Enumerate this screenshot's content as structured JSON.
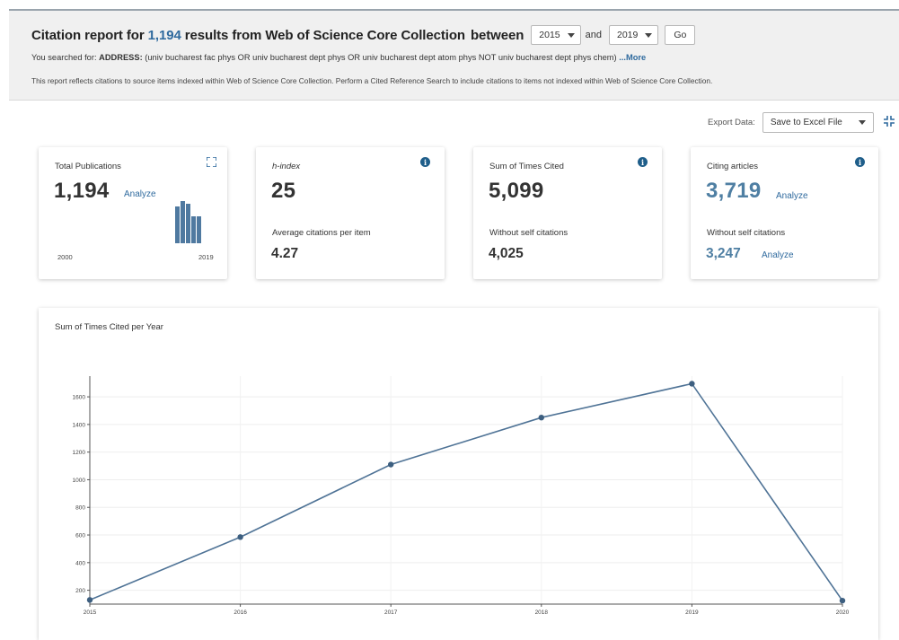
{
  "header": {
    "title_prefix": "Citation report for ",
    "title_count": "1,194",
    "title_suffix": " results from Web of Science Core Collection",
    "title_between": "between",
    "year_from": "2015",
    "and_label": "and",
    "year_to": "2019",
    "go_label": "Go",
    "searched_prefix": "You searched for: ",
    "searched_field": "ADDRESS:",
    "searched_query": " (univ bucharest fac phys OR univ bucharest dept phys OR univ bucharest dept atom phys NOT univ bucharest dept phys chem) ",
    "more_label": "...More",
    "note": "This report reflects citations to source items indexed within Web of Science Core Collection. Perform a Cited Reference Search to include citations to items not indexed within Web of Science Core Collection."
  },
  "export": {
    "label": "Export Data:",
    "selected": "Save to Excel File"
  },
  "cards": {
    "publications": {
      "label": "Total Publications",
      "value": "1,194",
      "analyze": "Analyze",
      "axis_start": "2000",
      "axis_end": "2019",
      "mini_bar_levels": [
        0.88,
        1.0,
        0.93,
        0.64,
        0.64
      ]
    },
    "hindex": {
      "label": "h-index",
      "value": "25",
      "sub_label": "Average citations per item",
      "sub_value": "4.27"
    },
    "times_cited": {
      "label": "Sum of Times Cited",
      "value": "5,099",
      "sub_label": "Without self citations",
      "sub_value": "4,025"
    },
    "citing": {
      "label": "Citing articles",
      "value": "3,719",
      "analyze": "Analyze",
      "sub_label": "Without self citations",
      "sub_value": "3,247",
      "sub_analyze": "Analyze"
    }
  },
  "colors": {
    "accent": "#2f6a9e",
    "value_blue": "#4f7fa3",
    "info": "#1f5e8a",
    "line": "#4f7396"
  },
  "chart_data": {
    "type": "line",
    "title": "Sum of Times Cited per Year",
    "x": [
      "2015",
      "2016",
      "2017",
      "2018",
      "2019",
      "2020"
    ],
    "values": [
      130,
      585,
      1110,
      1450,
      1695,
      125
    ],
    "ylim": [
      100,
      1750
    ],
    "yticks": [
      200,
      400,
      600,
      800,
      1000,
      1200,
      1400,
      1600
    ],
    "grid": true
  }
}
